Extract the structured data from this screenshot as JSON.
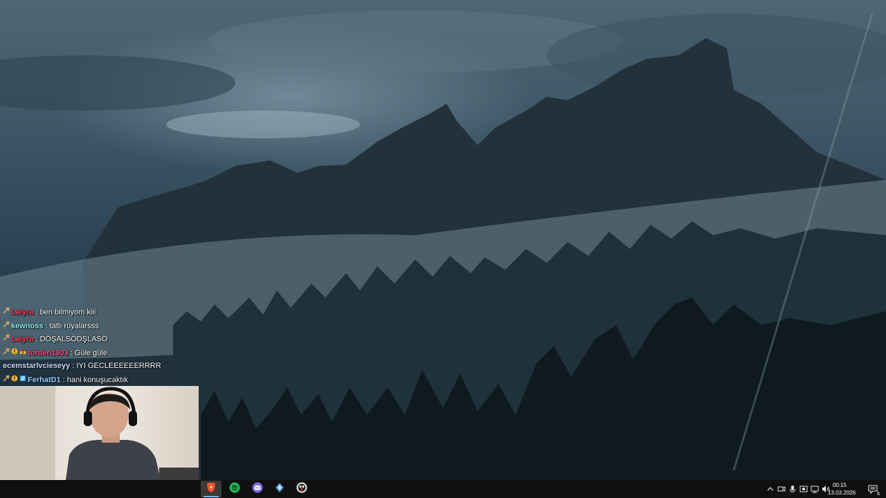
{
  "chat": {
    "messages": [
      {
        "user": "Laiyra",
        "user_color": "#ff3b5c",
        "separator": ":",
        "text": "ben bilmiyom kiii",
        "badges": [
          "sword"
        ]
      },
      {
        "user": "kewnoss",
        "user_color": "#8ef0e6",
        "separator": ":",
        "text": "tatlı rüyalarsss",
        "badges": [
          "sword"
        ]
      },
      {
        "user": "Laiyra",
        "user_color": "#ff3b5c",
        "separator": ":",
        "text": "DÖŞALSÖDŞLASÖ",
        "badges": [
          "sword"
        ]
      },
      {
        "user": "torden1903",
        "user_color": "#ff4d88",
        "separator": ":",
        "text": "Güle güle",
        "badges": [
          "sword",
          "gold",
          "gift"
        ]
      },
      {
        "user": "ecemstarlvcieseyy",
        "user_color": "#cfd8ff",
        "separator": ":",
        "text": "IYI GECLEEEEEERRRR",
        "badges": []
      },
      {
        "user": "FerhatD1",
        "user_color": "#9ad0ff",
        "separator": ":",
        "text": "hani konuşucaktık",
        "badges": [
          "sword",
          "gold",
          "sub"
        ]
      }
    ]
  },
  "taskbar": {
    "apps": [
      {
        "name": "brave-browser-icon",
        "color": "#fb542b",
        "active": true
      },
      {
        "name": "spotify-icon",
        "color": "#1db954",
        "active": false
      },
      {
        "name": "discord-icon",
        "color": "#7e6be8",
        "active": false
      },
      {
        "name": "app-shield-icon",
        "color": "#4a90d9",
        "active": false
      },
      {
        "name": "obs-icon",
        "color": "#f0f0f0",
        "active": false
      }
    ],
    "tray_icons": [
      "chevron-up-icon",
      "meet-now-icon",
      "microphone-icon",
      "speaker-settings-icon",
      "network-icon",
      "display-icon",
      "volume-icon"
    ],
    "time": "00:15",
    "date": "13.03.2026",
    "notification_count": "6"
  }
}
